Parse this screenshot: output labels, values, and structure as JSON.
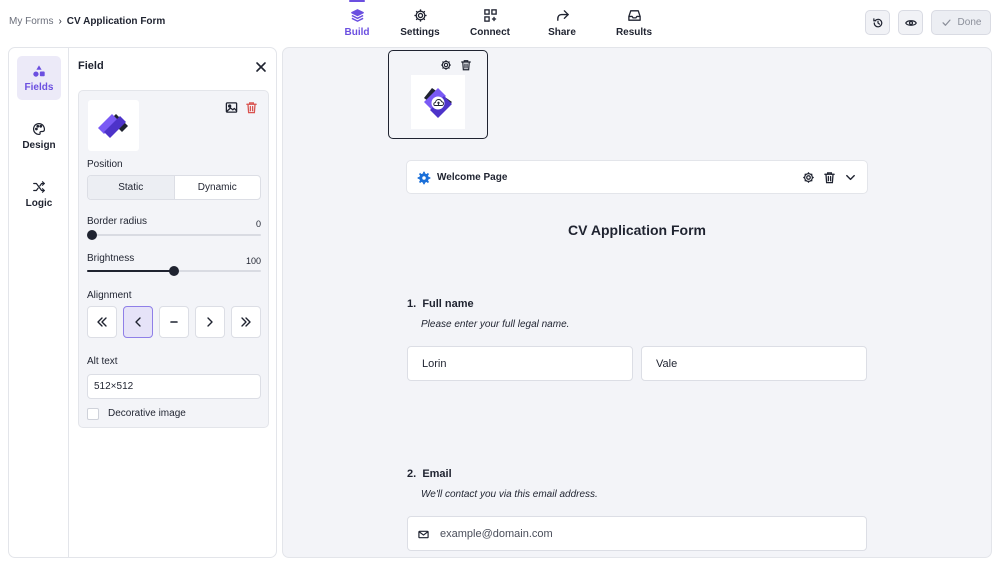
{
  "breadcrumb": {
    "root": "My Forms",
    "separator": "›",
    "current": "CV Application Form"
  },
  "nav_tabs": [
    {
      "label": "Build",
      "icon": "layers-icon",
      "active": true
    },
    {
      "label": "Settings",
      "icon": "gear-icon",
      "active": false
    },
    {
      "label": "Connect",
      "icon": "connect-grid-icon",
      "active": false
    },
    {
      "label": "Share",
      "icon": "share-arrow-icon",
      "active": false
    },
    {
      "label": "Results",
      "icon": "inbox-icon",
      "active": false
    }
  ],
  "top_actions": {
    "history_icon": "history-icon",
    "preview_icon": "eye-icon",
    "done_label": "Done"
  },
  "rail": [
    {
      "label": "Fields",
      "icon": "shapes-icon",
      "active": true
    },
    {
      "label": "Design",
      "icon": "palette-icon",
      "active": false
    },
    {
      "label": "Logic",
      "icon": "shuffle-icon",
      "active": false
    }
  ],
  "field_panel": {
    "title": "Field",
    "position_label": "Position",
    "position_options": [
      "Static",
      "Dynamic"
    ],
    "position_selected": "Static",
    "border_radius_label": "Border radius",
    "border_radius_value": "0",
    "brightness_label": "Brightness",
    "brightness_value": "100",
    "brightness_fraction": 0.5,
    "border_radius_fraction": 0.0,
    "alignment_label": "Alignment",
    "alignment_options": [
      "far-left",
      "left",
      "center",
      "right",
      "far-right"
    ],
    "alignment_selected": "left",
    "alt_text_label": "Alt text",
    "alt_text_value": "512×512",
    "decorative_label": "Decorative image",
    "decorative_checked": false
  },
  "canvas": {
    "welcome_page_label": "Welcome Page",
    "form_title": "CV Application Form",
    "questions": [
      {
        "number": "1.",
        "title": "Full name",
        "description": "Please enter your full legal name.",
        "values": [
          "Lorin",
          "Vale"
        ]
      },
      {
        "number": "2.",
        "title": "Email",
        "description": "We'll contact you via this email address.",
        "placeholder": "example@domain.com"
      }
    ]
  },
  "colors": {
    "accent": "#6b4fe0",
    "text": "#1f2330",
    "canvas_bg": "#f3f4f8",
    "danger": "#d9534f"
  }
}
